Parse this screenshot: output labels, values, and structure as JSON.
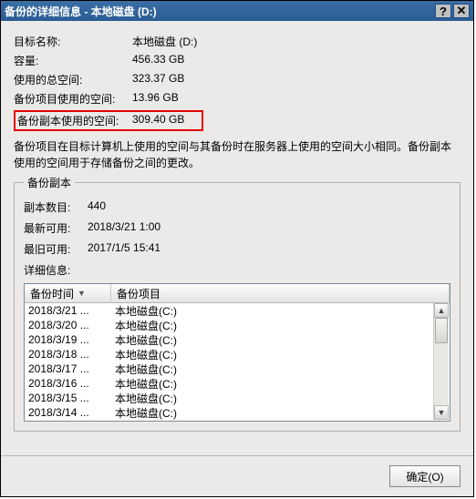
{
  "window": {
    "title": "备份的详细信息 - 本地磁盘 (D:)"
  },
  "info": {
    "target_name_label": "目标名称:",
    "target_name_value": "本地磁盘 (D:)",
    "capacity_label": "容量:",
    "capacity_value": "456.33 GB",
    "used_total_label": "使用的总空间:",
    "used_total_value": "323.37 GB",
    "backup_item_used_label": "备份项目使用的空间:",
    "backup_item_used_value": "13.96 GB",
    "backup_copy_used_label": "备份副本使用的空间:",
    "backup_copy_used_value": "309.40 GB"
  },
  "description": "备份项目在目标计算机上使用的空间与其备份时在服务器上使用的空间大小相同。备份副本使用的空间用于存储备份之间的更改。",
  "group": {
    "legend": "备份副本",
    "copies_label": "副本数目:",
    "copies_value": "440",
    "latest_label": "最新可用:",
    "latest_value": "2018/3/21 1:00",
    "oldest_label": "最旧可用:",
    "oldest_value": "2017/1/5 15:41",
    "details_label": "详细信息:"
  },
  "list": {
    "col_time": "备份时间",
    "col_item": "备份项目",
    "rows": [
      {
        "time": "2018/3/21 ...",
        "item": "本地磁盘(C:)"
      },
      {
        "time": "2018/3/20 ...",
        "item": "本地磁盘(C:)"
      },
      {
        "time": "2018/3/19 ...",
        "item": "本地磁盘(C:)"
      },
      {
        "time": "2018/3/18 ...",
        "item": "本地磁盘(C:)"
      },
      {
        "time": "2018/3/17 ...",
        "item": "本地磁盘(C:)"
      },
      {
        "time": "2018/3/16 ...",
        "item": "本地磁盘(C:)"
      },
      {
        "time": "2018/3/15 ...",
        "item": "本地磁盘(C:)"
      },
      {
        "time": "2018/3/14 ...",
        "item": "本地磁盘(C:)"
      }
    ]
  },
  "buttons": {
    "ok": "确定(O)"
  }
}
